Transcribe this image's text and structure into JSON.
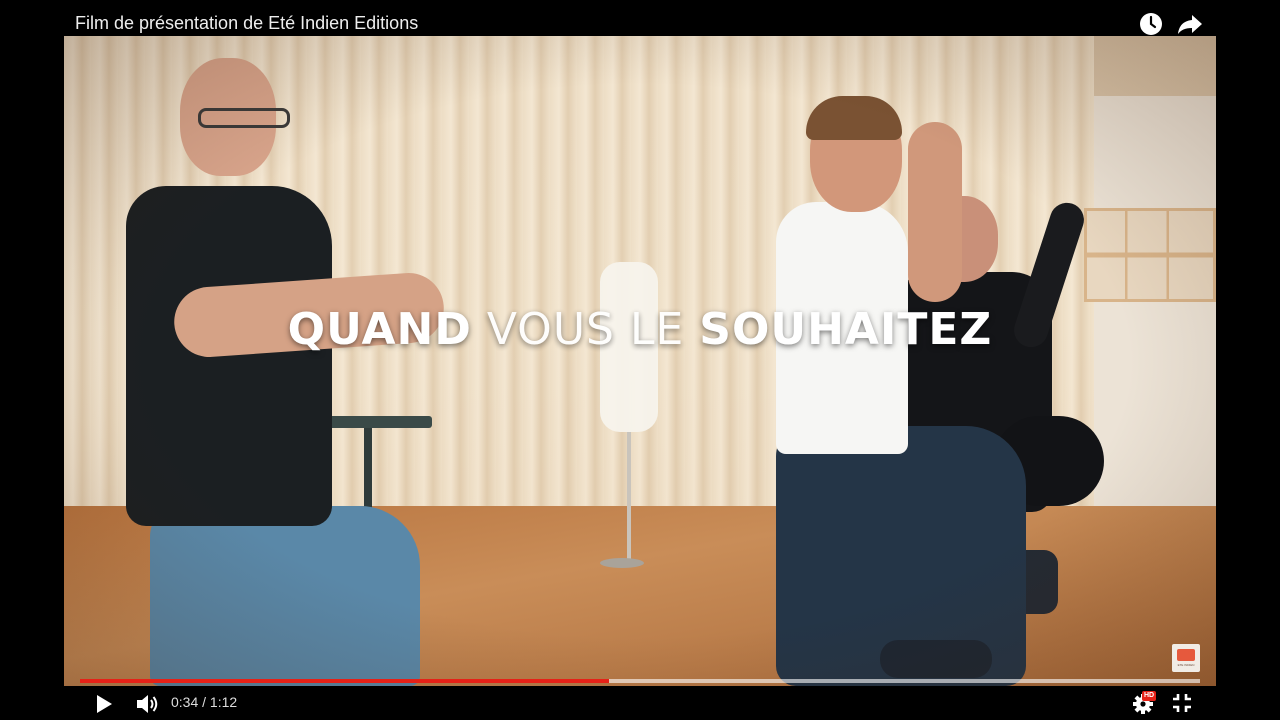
{
  "title_bar": {
    "title": "Film de présentation de Eté Indien Editions",
    "watch_later_icon": "clock-icon",
    "share_icon": "share-arrow-icon"
  },
  "video": {
    "overlay_words": [
      {
        "text": "QUAND",
        "weight": "bold"
      },
      {
        "text": "VOUS",
        "weight": "light"
      },
      {
        "text": "LE",
        "weight": "light"
      },
      {
        "text": "SOUHAITEZ",
        "weight": "bold"
      }
    ],
    "channel_logo_icon": "ete-indien-logo-icon",
    "channel_logo_text": "ETE INDIEN"
  },
  "progress": {
    "played_fraction": 0.4722,
    "loaded_fraction": 1.0,
    "played_color": "#e62117"
  },
  "controls": {
    "play_icon": "play-icon",
    "volume_icon": "volume-icon",
    "time": "0:34 / 1:12",
    "settings_icon": "gear-icon",
    "hd_label": "HD",
    "fullscreen_icon": "exit-fullscreen-icon"
  }
}
